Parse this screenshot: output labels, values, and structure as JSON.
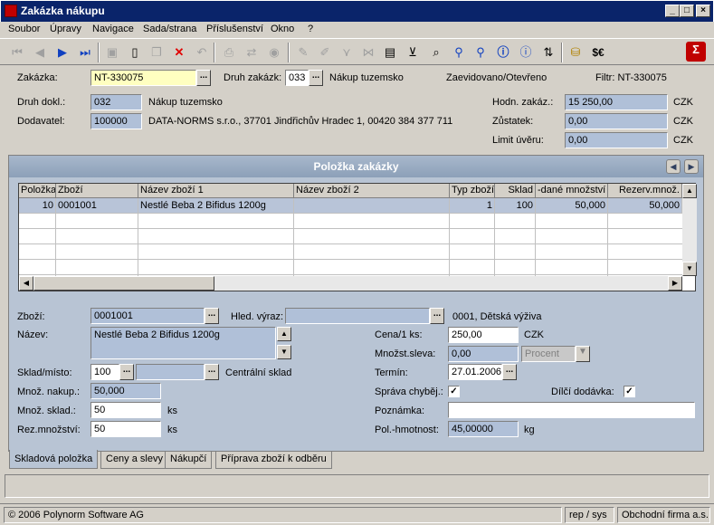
{
  "window": {
    "title": "Zakázka nákupu"
  },
  "menu": [
    "Soubor",
    "Úpravy",
    "Navigace",
    "Sada/strana",
    "Příslušenství",
    "Okno",
    "?"
  ],
  "toolbar": {
    "currency": "$€"
  },
  "header": {
    "zakazka_label": "Zakázka:",
    "zakazka_value": "NT-330075",
    "druh_zakazk_label": "Druh zakázk:",
    "druh_zakazk_value": "033",
    "druh_zakazk_text": "Nákup tuzemsko",
    "status": "Zaevidovano/Otevřeno",
    "filtr": "Filtr:  NT-330075",
    "druh_dokl_label": "Druh dokl.:",
    "druh_dokl_value": "032",
    "druh_dokl_text": "Nákup tuzemsko",
    "dodavatel_label": "Dodavatel:",
    "dodavatel_value": "100000",
    "dodavatel_text": "DATA-NORMS s.r.o., 37701 Jindřichův Hradec 1, 00420 384 377 711",
    "hodn_label": "Hodn. zakáz.:",
    "hodn_value": "15 250,00",
    "zustatek_label": "Zůstatek:",
    "zustatek_value": "0,00",
    "limit_label": "Limit úvěru:",
    "limit_value": "0,00",
    "currency": "CZK"
  },
  "panel": {
    "title": "Položka zakázky"
  },
  "grid": {
    "columns": [
      "Položka",
      "Zboží",
      "Název zboží 1",
      "Název zboží 2",
      "Typ zboží",
      "Sklad",
      "-dané množství",
      "Rezerv.množ."
    ],
    "rows": [
      [
        "10",
        "0001001",
        "Nestlé Beba 2 Bifidus 1200g",
        "",
        "1",
        "100",
        "50,000",
        "50,000"
      ]
    ]
  },
  "detail": {
    "zbozi_label": "Zboží:",
    "zbozi_value": "0001001",
    "hled_label": "Hled. výraz:",
    "hled_value": "",
    "zbozi_info": "0001, Dětská výživa",
    "nazev_label": "Název:",
    "nazev_value": "Nestlé Beba 2 Bifidus 1200g",
    "sklad_label": "Sklad/místo:",
    "sklad_value": "100",
    "sklad_text": "Centrální sklad",
    "mnoz_nakup_label": "Množ. nakup.:",
    "mnoz_nakup_value": "50,000",
    "mnoz_sklad_label": "Množ. sklad.:",
    "mnoz_sklad_value": "50",
    "rez_label": "Rez.množství:",
    "rez_value": "50",
    "unit": "ks",
    "cena_label": "Cena/1 ks:",
    "cena_value": "250,00",
    "mnoz_sleva_label": "Množst.sleva:",
    "mnoz_sleva_value": "0,00",
    "sleva_type": "Procent",
    "termin_label": "Termín:",
    "termin_value": "27.01.2006",
    "sprava_label": "Správa chyběj.:",
    "dilci_label": "Dílčí dodávka:",
    "poznamka_label": "Poznámka:",
    "poznamka_value": "",
    "hmotnost_label": "Pol.-hmotnost:",
    "hmotnost_value": "45,00000",
    "hmotnost_unit": "kg"
  },
  "tabs": [
    "Skladová položka",
    "Ceny a slevy",
    "Nákupčí",
    "Příprava zboží k odběru"
  ],
  "status": {
    "copyright": "© 2006 Polynorm Software AG",
    "user": "rep / sys",
    "company": "Obchodní firma a.s."
  }
}
